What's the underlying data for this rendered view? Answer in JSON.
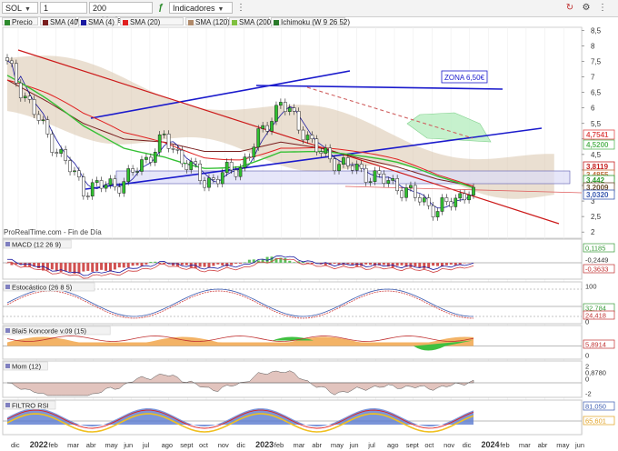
{
  "toolbar": {
    "ticker": "SOL",
    "period": "1 semana",
    "units": "200 unidades",
    "indicators": "Indicadores"
  },
  "legend": [
    {
      "label": "Precio",
      "color": "#2e8b2e"
    },
    {
      "label": "SMA (40)",
      "color": "#7a1f1f"
    },
    {
      "label": "SMA (4)",
      "color": "#1a1aa0"
    },
    {
      "label": "SMA (20)",
      "color": "#e02020"
    },
    {
      "label": "SMA (120)",
      "color": "#b08a6a"
    },
    {
      "label": "SMA (200)",
      "color": "#80c040"
    },
    {
      "label": "Ichimoku (W 9 26 52)",
      "color": "#2a7a2a"
    }
  ],
  "annotation": "ZONA 6,50€",
  "watermark": "ProRealTime.com - Fin de Día",
  "price_axis": [
    "8,5",
    "8",
    "7,5",
    "7",
    "6,5",
    "6",
    "5,5",
    "5",
    "4,5",
    "4",
    "3,5",
    "3",
    "2,5",
    "2"
  ],
  "price_badges": [
    {
      "text": "4,7541",
      "color": "#e05050"
    },
    {
      "text": "4,5200",
      "color": "#5cb85c"
    },
    {
      "text": "3,8119",
      "color": "#c62020"
    },
    {
      "text": "3,4855",
      "color": "#c07040"
    },
    {
      "text": "3,442",
      "color": "#2a9a2a"
    },
    {
      "text": "3,2009",
      "color": "#6a4a2a"
    },
    {
      "text": "3,0320",
      "color": "#3a5ab0"
    }
  ],
  "panels": [
    {
      "title": "MACD (12 26 9)",
      "axis": [
        "0,1185",
        "-0,2449",
        "-0,3633"
      ],
      "axis_colors": [
        "#3a9a3a",
        "#333333",
        "#c03030"
      ]
    },
    {
      "title": "Estocástico (26 8 5)",
      "axis": [
        "100",
        "32,784",
        "24,418",
        "0"
      ],
      "axis_colors": [
        "#333333",
        "#3a9a3a",
        "#c03030",
        "#333333"
      ]
    },
    {
      "title": "Blai5 Koncorde v.09 (15)",
      "axis": [
        "5,8914",
        "0"
      ],
      "axis_colors": [
        "#c03030",
        "#333333"
      ]
    },
    {
      "title": "Mom (12)",
      "axis": [
        "2",
        "0,8780",
        "0",
        "-2"
      ],
      "axis_colors": [
        "#333333",
        "#333333",
        "#333333",
        "#333333"
      ]
    },
    {
      "title": "FILTRO RSI",
      "axis": [
        "81,050",
        "65,601"
      ],
      "axis_colors": [
        "#3a5ab0",
        "#e0a020"
      ]
    }
  ],
  "time_axis": [
    "dic",
    "2022",
    "feb",
    "mar",
    "abr",
    "may",
    "jun",
    "jul",
    "ago",
    "sept",
    "oct",
    "nov",
    "dic",
    "2023",
    "feb",
    "mar",
    "abr",
    "may",
    "jun",
    "jul",
    "ago",
    "sept",
    "oct",
    "nov",
    "dic",
    "2024",
    "feb",
    "mar",
    "abr",
    "may",
    "jun"
  ],
  "chart_data": {
    "type": "line",
    "title": "SOL",
    "x": [
      "2022-01",
      "2022-03",
      "2022-05",
      "2022-07",
      "2022-09",
      "2022-11",
      "2023-01",
      "2023-03",
      "2023-05",
      "2023-07",
      "2023-09",
      "2023-11",
      "2023-12"
    ],
    "series": [
      {
        "name": "Precio",
        "values": [
          7.4,
          5.1,
          3.4,
          3.6,
          5.0,
          3.6,
          4.1,
          6.2,
          4.5,
          4.0,
          3.5,
          2.7,
          3.44
        ]
      },
      {
        "name": "SMA (40)",
        "values": [
          6.9,
          6.2,
          5.5,
          5.0,
          4.9,
          4.6,
          4.6,
          4.9,
          4.7,
          4.4,
          4.1,
          3.7,
          3.48
        ]
      }
    ],
    "ylim": [
      1.8,
      8.6
    ],
    "last_price": 3.442
  }
}
